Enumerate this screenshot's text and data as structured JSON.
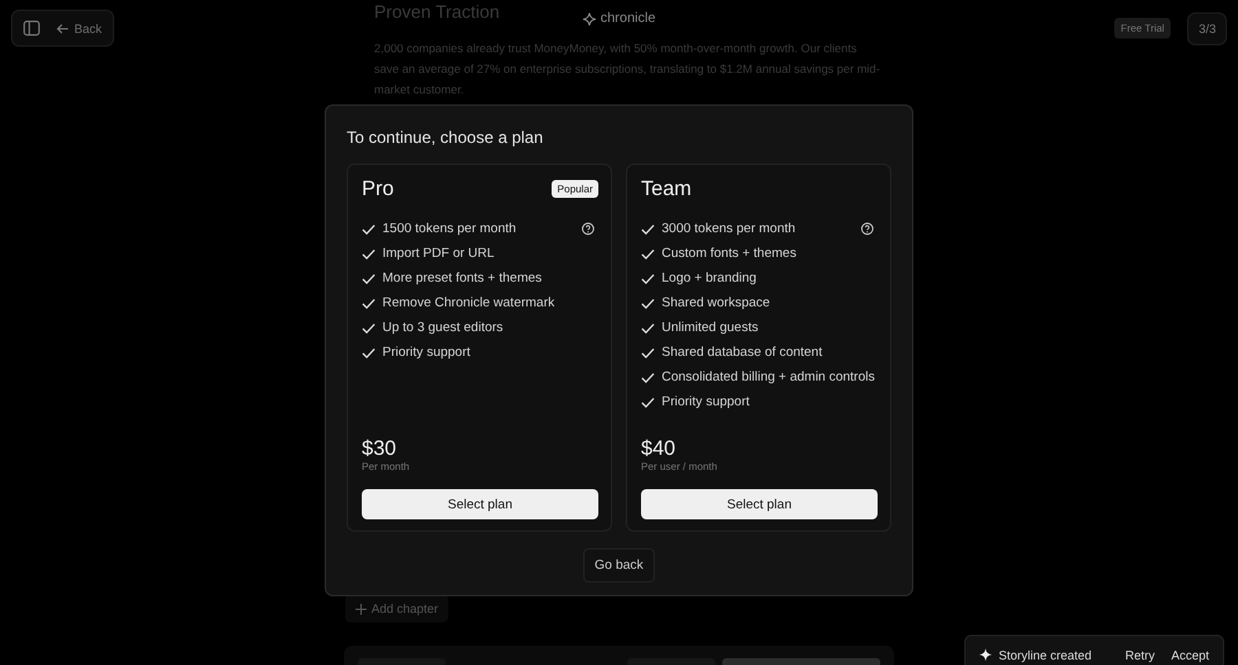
{
  "topbar": {
    "back": "Back",
    "logo": "chronicle",
    "badge": "Free Trial",
    "page_indicator": "3/3"
  },
  "background": {
    "heading": "Proven Traction",
    "paragraph": "2,000 companies already trust MoneyMoney, with 50% month-over-month growth. Our clients save an average of 27% on enterprise subscriptions, translating to $1.2M annual savings per mid-market customer.",
    "add_chapter": "Add chapter"
  },
  "dialog": {
    "title": "To continue, choose a plan",
    "plans": [
      {
        "name": "Pro",
        "badge": "Popular",
        "features": [
          {
            "text": "1500 tokens per month",
            "info": true
          },
          {
            "text": "Import PDF or URL",
            "info": false
          },
          {
            "text": "More preset fonts + themes",
            "info": false
          },
          {
            "text": "Remove Chronicle watermark",
            "info": false
          },
          {
            "text": "Up to 3 guest editors",
            "info": false
          },
          {
            "text": "Priority support",
            "info": false
          }
        ],
        "price": "$30",
        "period": "Per month",
        "button": "Select plan"
      },
      {
        "name": "Team",
        "features": [
          {
            "text": "3000 tokens per month",
            "info": true
          },
          {
            "text": "Custom fonts + themes",
            "info": false
          },
          {
            "text": "Logo + branding",
            "info": false
          },
          {
            "text": "Shared workspace",
            "info": false
          },
          {
            "text": "Unlimited guests",
            "info": false
          },
          {
            "text": "Shared database of content",
            "info": false
          },
          {
            "text": "Consolidated billing + admin controls",
            "info": false
          },
          {
            "text": "Priority support",
            "info": false
          }
        ],
        "price": "$40",
        "period": "Per user / month",
        "button": "Select plan"
      }
    ],
    "secondary_button": "Go back"
  },
  "toast": {
    "message": "Storyline created",
    "actions": [
      "Retry",
      "Accept"
    ]
  }
}
